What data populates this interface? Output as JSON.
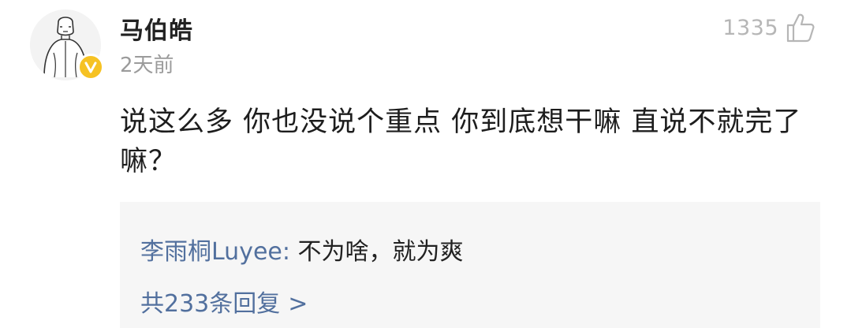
{
  "comment": {
    "author": "马伯皓",
    "time": "2天前",
    "like_count": "1335",
    "avatar_icon": "avatar-sketch-icon",
    "verified_icon": "verified-v-icon",
    "like_icon": "thumbs-up-icon",
    "text": "说这么多 你也没说个重点 你到底想干嘛 直说不就完了嘛？"
  },
  "reply_preview": {
    "author": "李雨桐Luyee",
    "separator": ": ",
    "text": "不为啥，就为爽",
    "more_label": "共233条回复",
    "more_chevron": ">"
  },
  "colors": {
    "link_blue": "#52709e",
    "badge_yellow": "#f6c223",
    "muted_gray": "#9b9b9b",
    "reply_bg": "#f6f6f6"
  }
}
